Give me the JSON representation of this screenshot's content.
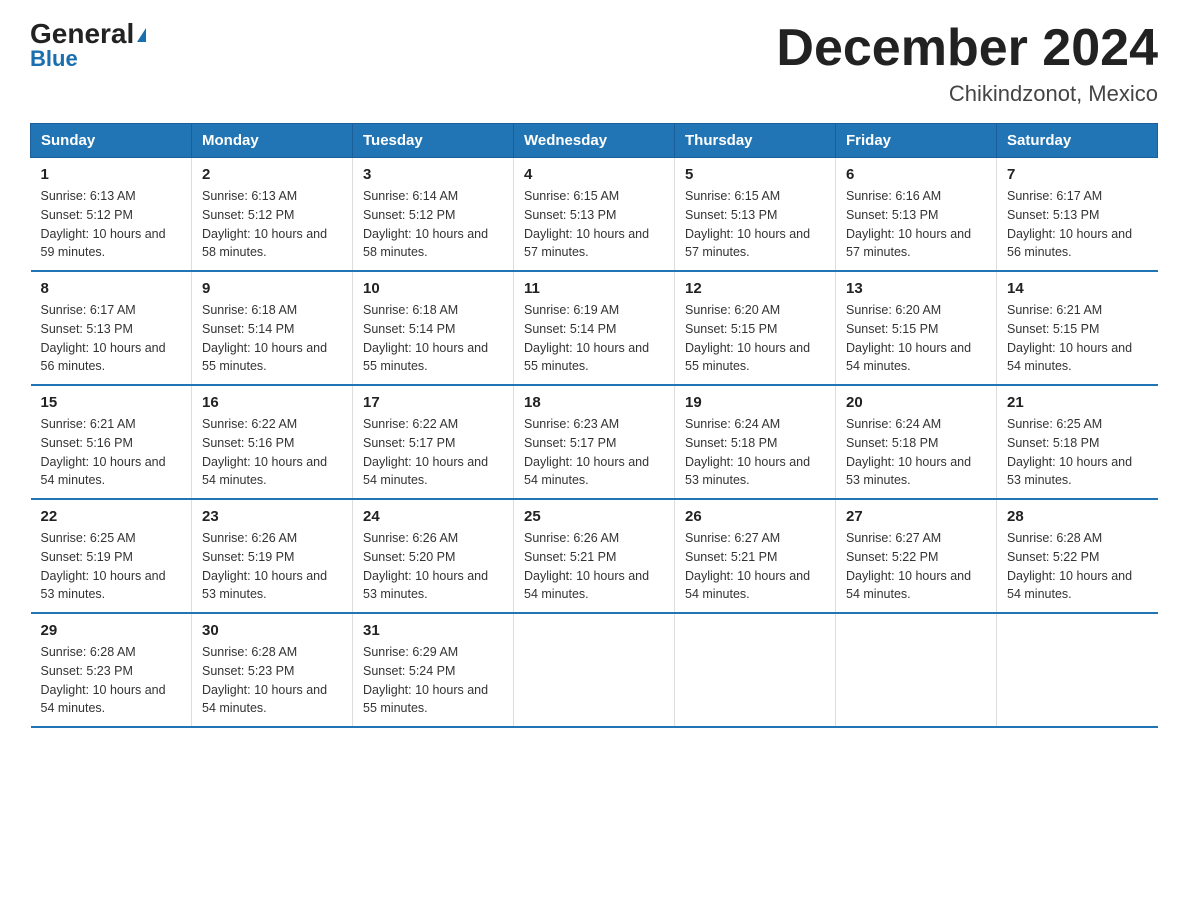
{
  "logo": {
    "part1": "General",
    "part2": "Blue"
  },
  "title": "December 2024",
  "subtitle": "Chikindzonot, Mexico",
  "headers": [
    "Sunday",
    "Monday",
    "Tuesday",
    "Wednesday",
    "Thursday",
    "Friday",
    "Saturday"
  ],
  "weeks": [
    [
      {
        "day": "1",
        "sunrise": "6:13 AM",
        "sunset": "5:12 PM",
        "daylight": "10 hours and 59 minutes."
      },
      {
        "day": "2",
        "sunrise": "6:13 AM",
        "sunset": "5:12 PM",
        "daylight": "10 hours and 58 minutes."
      },
      {
        "day": "3",
        "sunrise": "6:14 AM",
        "sunset": "5:12 PM",
        "daylight": "10 hours and 58 minutes."
      },
      {
        "day": "4",
        "sunrise": "6:15 AM",
        "sunset": "5:13 PM",
        "daylight": "10 hours and 57 minutes."
      },
      {
        "day": "5",
        "sunrise": "6:15 AM",
        "sunset": "5:13 PM",
        "daylight": "10 hours and 57 minutes."
      },
      {
        "day": "6",
        "sunrise": "6:16 AM",
        "sunset": "5:13 PM",
        "daylight": "10 hours and 57 minutes."
      },
      {
        "day": "7",
        "sunrise": "6:17 AM",
        "sunset": "5:13 PM",
        "daylight": "10 hours and 56 minutes."
      }
    ],
    [
      {
        "day": "8",
        "sunrise": "6:17 AM",
        "sunset": "5:13 PM",
        "daylight": "10 hours and 56 minutes."
      },
      {
        "day": "9",
        "sunrise": "6:18 AM",
        "sunset": "5:14 PM",
        "daylight": "10 hours and 55 minutes."
      },
      {
        "day": "10",
        "sunrise": "6:18 AM",
        "sunset": "5:14 PM",
        "daylight": "10 hours and 55 minutes."
      },
      {
        "day": "11",
        "sunrise": "6:19 AM",
        "sunset": "5:14 PM",
        "daylight": "10 hours and 55 minutes."
      },
      {
        "day": "12",
        "sunrise": "6:20 AM",
        "sunset": "5:15 PM",
        "daylight": "10 hours and 55 minutes."
      },
      {
        "day": "13",
        "sunrise": "6:20 AM",
        "sunset": "5:15 PM",
        "daylight": "10 hours and 54 minutes."
      },
      {
        "day": "14",
        "sunrise": "6:21 AM",
        "sunset": "5:15 PM",
        "daylight": "10 hours and 54 minutes."
      }
    ],
    [
      {
        "day": "15",
        "sunrise": "6:21 AM",
        "sunset": "5:16 PM",
        "daylight": "10 hours and 54 minutes."
      },
      {
        "day": "16",
        "sunrise": "6:22 AM",
        "sunset": "5:16 PM",
        "daylight": "10 hours and 54 minutes."
      },
      {
        "day": "17",
        "sunrise": "6:22 AM",
        "sunset": "5:17 PM",
        "daylight": "10 hours and 54 minutes."
      },
      {
        "day": "18",
        "sunrise": "6:23 AM",
        "sunset": "5:17 PM",
        "daylight": "10 hours and 54 minutes."
      },
      {
        "day": "19",
        "sunrise": "6:24 AM",
        "sunset": "5:18 PM",
        "daylight": "10 hours and 53 minutes."
      },
      {
        "day": "20",
        "sunrise": "6:24 AM",
        "sunset": "5:18 PM",
        "daylight": "10 hours and 53 minutes."
      },
      {
        "day": "21",
        "sunrise": "6:25 AM",
        "sunset": "5:18 PM",
        "daylight": "10 hours and 53 minutes."
      }
    ],
    [
      {
        "day": "22",
        "sunrise": "6:25 AM",
        "sunset": "5:19 PM",
        "daylight": "10 hours and 53 minutes."
      },
      {
        "day": "23",
        "sunrise": "6:26 AM",
        "sunset": "5:19 PM",
        "daylight": "10 hours and 53 minutes."
      },
      {
        "day": "24",
        "sunrise": "6:26 AM",
        "sunset": "5:20 PM",
        "daylight": "10 hours and 53 minutes."
      },
      {
        "day": "25",
        "sunrise": "6:26 AM",
        "sunset": "5:21 PM",
        "daylight": "10 hours and 54 minutes."
      },
      {
        "day": "26",
        "sunrise": "6:27 AM",
        "sunset": "5:21 PM",
        "daylight": "10 hours and 54 minutes."
      },
      {
        "day": "27",
        "sunrise": "6:27 AM",
        "sunset": "5:22 PM",
        "daylight": "10 hours and 54 minutes."
      },
      {
        "day": "28",
        "sunrise": "6:28 AM",
        "sunset": "5:22 PM",
        "daylight": "10 hours and 54 minutes."
      }
    ],
    [
      {
        "day": "29",
        "sunrise": "6:28 AM",
        "sunset": "5:23 PM",
        "daylight": "10 hours and 54 minutes."
      },
      {
        "day": "30",
        "sunrise": "6:28 AM",
        "sunset": "5:23 PM",
        "daylight": "10 hours and 54 minutes."
      },
      {
        "day": "31",
        "sunrise": "6:29 AM",
        "sunset": "5:24 PM",
        "daylight": "10 hours and 55 minutes."
      },
      null,
      null,
      null,
      null
    ]
  ]
}
